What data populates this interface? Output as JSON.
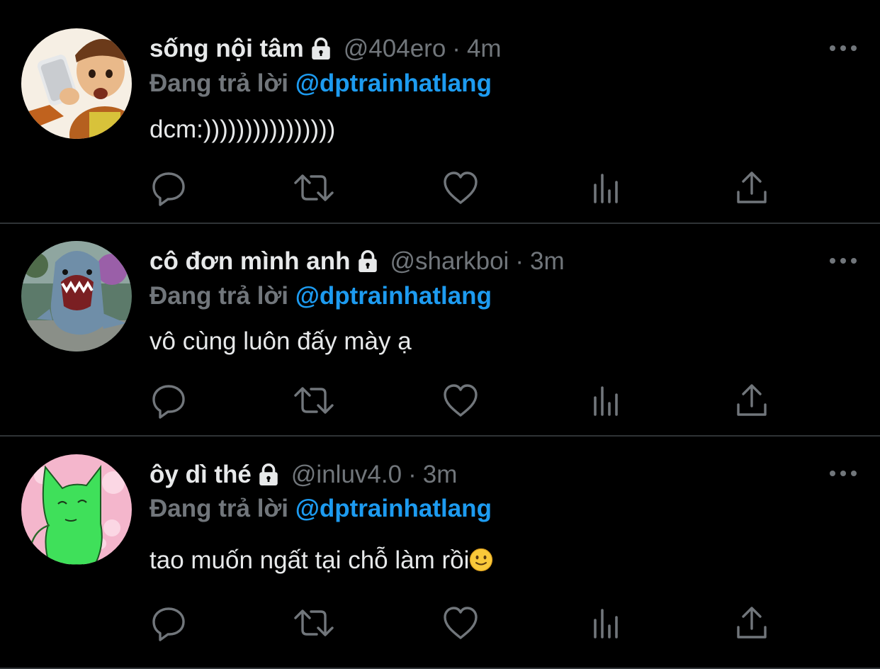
{
  "colors": {
    "background": "#000000",
    "primary_text": "#e7e9ea",
    "secondary_text": "#71767b",
    "accent": "#1d9bf0",
    "divider": "#2f3336"
  },
  "tweets": [
    {
      "display_name": "sống nội tâm",
      "handle": "@404ero",
      "separator": "·",
      "time": "4m",
      "reply_prefix": "Đang trả lời",
      "reply_to": "@dptrainhatlang",
      "text": "dcm:))))))))))))))))",
      "avatar_icon": "woody-avatar",
      "protected_icon": "lock-icon"
    },
    {
      "display_name": "cô đơn mình anh",
      "handle": "@sharkboi",
      "separator": "·",
      "time": "3m",
      "reply_prefix": "Đang trả lời",
      "reply_to": "@dptrainhatlang",
      "text": "vô cùng luôn đấy mày ạ",
      "avatar_icon": "shark-avatar",
      "protected_icon": "lock-icon"
    },
    {
      "display_name": "ôy dì thé",
      "handle": "@inluv4.0",
      "separator": "·",
      "time": "3m",
      "reply_prefix": "Đang trả lời",
      "reply_to": "@dptrainhatlang",
      "text": "tao muốn ngất tại chỗ làm rồi",
      "text_emoji": "slightly-smiling-face-emoji",
      "avatar_icon": "green-cat-avatar",
      "protected_icon": "lock-icon"
    }
  ],
  "action_icons": [
    "reply-icon",
    "retweet-icon",
    "like-icon",
    "analytics-icon",
    "share-icon"
  ]
}
